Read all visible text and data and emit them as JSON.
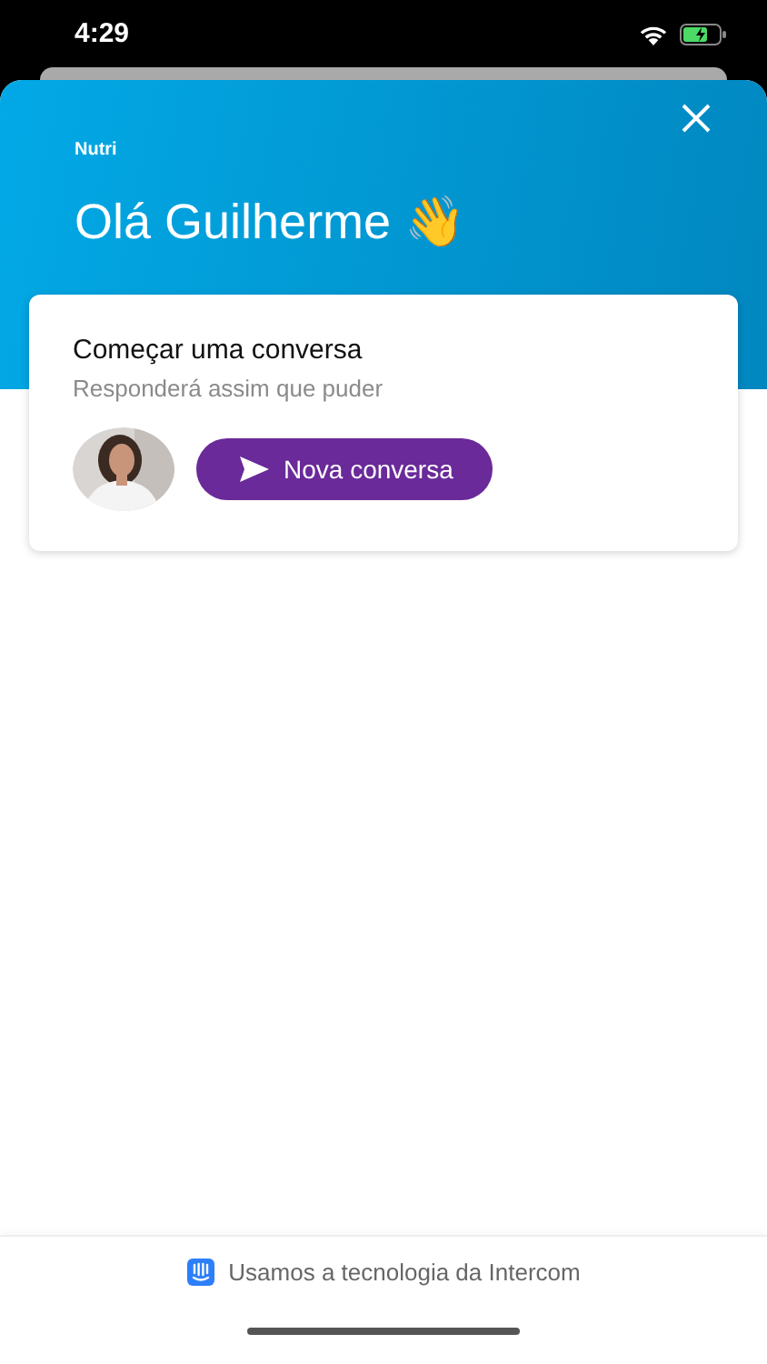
{
  "status_bar": {
    "time": "4:29"
  },
  "header": {
    "logo": "Nutri",
    "greeting": "Olá Guilherme 👋"
  },
  "card": {
    "title": "Começar uma conversa",
    "subtitle": "Responderá assim que puder",
    "button": "Nova conversa"
  },
  "footer": {
    "text": "Usamos a tecnologia da Intercom"
  }
}
